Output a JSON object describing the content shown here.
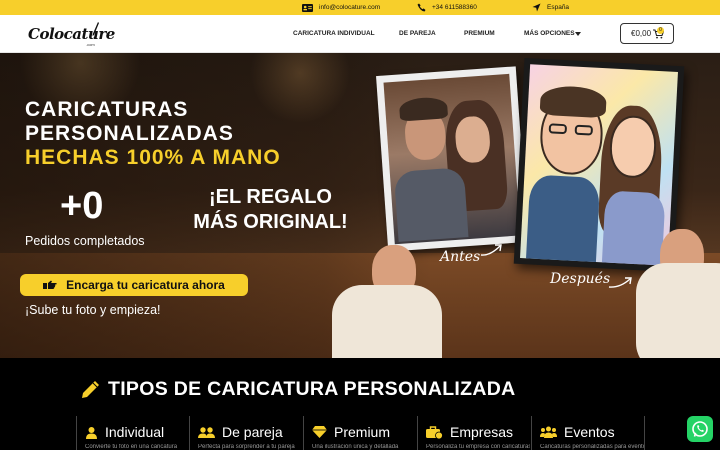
{
  "topbar": {
    "email": "info@colocature.com",
    "phone": "+34 611588360",
    "country": "España",
    "icons": [
      "contact-card-icon",
      "phone-icon",
      "location-arrow-icon"
    ],
    "color": "#f7cf2b"
  },
  "header": {
    "logo_text": "Colocature",
    "logo_sub": ".com",
    "nav": [
      "CARICATURA INDIVIDUAL",
      "DE PAREJA",
      "PREMIUM",
      "MÁS OPCIONES"
    ],
    "cart_amount": "€0,00",
    "cart_count": "0"
  },
  "hero": {
    "title_line1": "CARICATURAS",
    "title_line2": "PERSONALIZADAS",
    "title_line3": "HECHAS 100% A MANO",
    "counter": "+0",
    "counter_label": "Pedidos completados",
    "gift_line1": "¡EL REGALO",
    "gift_line2": "MÁS ORIGINAL!",
    "cta_label": "Encarga tu caricatura ahora",
    "upload_note": "¡Sube tu foto y empieza!",
    "before_label": "Antes",
    "after_label": "Después",
    "accent": "#f7cf2b"
  },
  "types": {
    "title": "TIPOS DE CARICATURA PERSONALIZADA",
    "cards": [
      {
        "label": "Individual",
        "desc": "Convierte tu foto en una caricatura",
        "icon": "user-icon"
      },
      {
        "label": "De pareja",
        "desc": "Perfecta para sorprender a tu pareja",
        "icon": "couple-icon"
      },
      {
        "label": "Premium",
        "desc": "Una ilustración única y detallada",
        "icon": "diamond-icon"
      },
      {
        "label": "Empresas",
        "desc": "Personaliza tu empresa con caricaturas",
        "icon": "briefcase-icon"
      },
      {
        "label": "Eventos",
        "desc": "Caricaturas personalizadas para eventos",
        "icon": "group-icon"
      }
    ]
  },
  "whatsapp": {
    "icon": "whatsapp-icon",
    "color": "#25d366"
  }
}
